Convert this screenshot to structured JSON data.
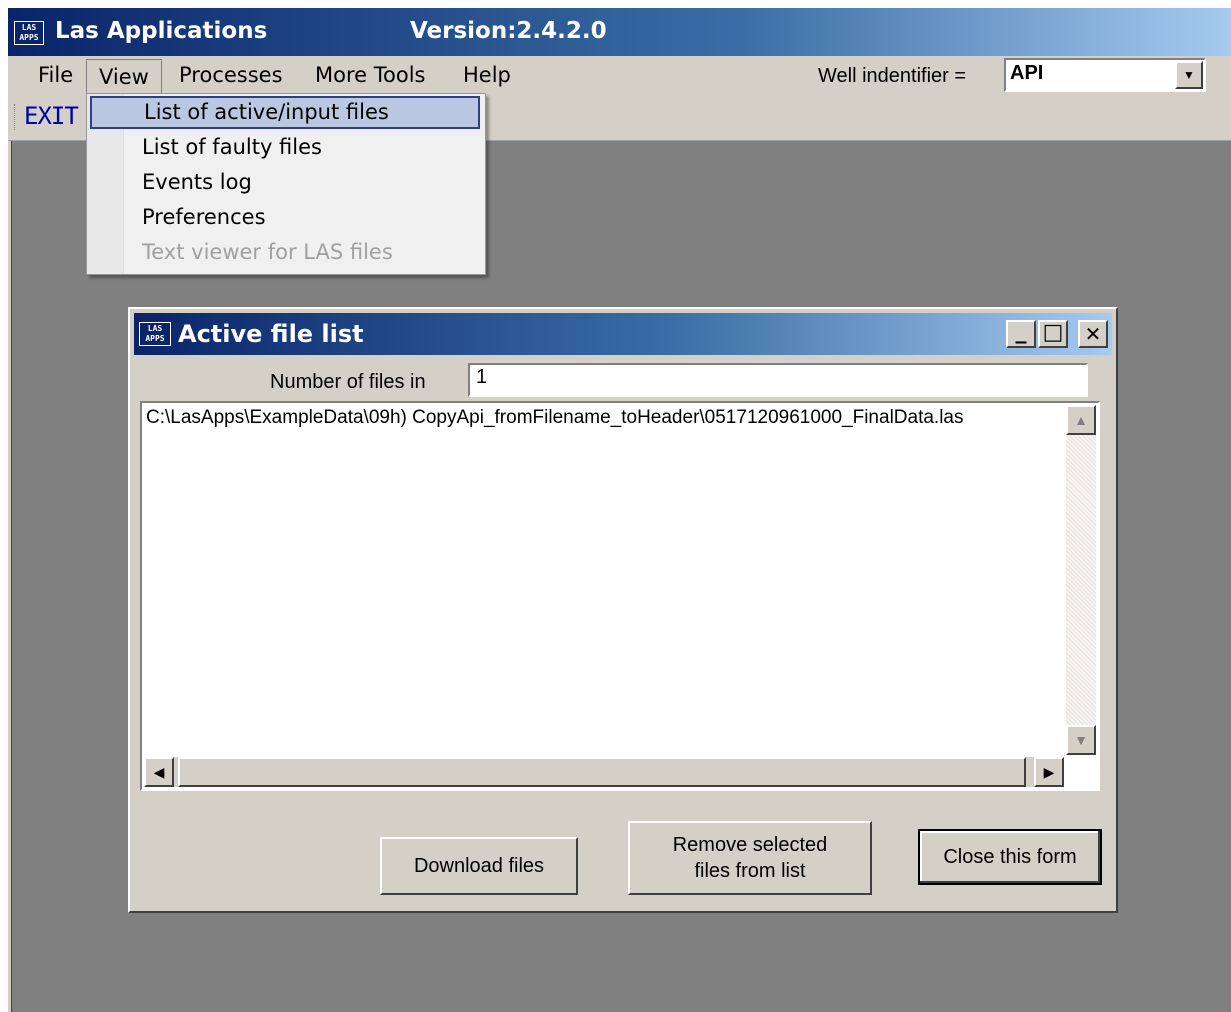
{
  "app": {
    "title": "Las Applications",
    "version": "Version:2.4.2.0",
    "icon_top": "LAS",
    "icon_bottom": "APPS"
  },
  "menubar": {
    "items": [
      "File",
      "View",
      "Processes",
      "More Tools",
      "Help"
    ],
    "active": "View",
    "well_identifier_label": "Well indentifier =",
    "well_identifier_value": "API"
  },
  "toolbar": {
    "exit_label": "EXIT S"
  },
  "view_menu": {
    "items": [
      {
        "label": "List of active/input files",
        "state": "highlighted"
      },
      {
        "label": "List of faulty files",
        "state": "enabled"
      },
      {
        "label": "Events log",
        "state": "enabled"
      },
      {
        "label": "Preferences",
        "state": "enabled"
      },
      {
        "label": "Text viewer for LAS files",
        "state": "disabled"
      }
    ]
  },
  "child_window": {
    "title": "Active file list",
    "icon_top": "LAS",
    "icon_bottom": "APPS",
    "minimize": "_",
    "maximize": "□",
    "close": "✕",
    "files_label": "Number of files in",
    "files_count": "1",
    "files": [
      "C:\\LasApps\\ExampleData\\09h) CopyApi_fromFilename_toHeader\\0517120961000_FinalData.las"
    ],
    "buttons": {
      "download": "Download files",
      "remove_line1": "Remove selected",
      "remove_line2": "files from list",
      "close": "Close this form"
    }
  },
  "colors": {
    "titlebar_start": "#0a246a",
    "titlebar_end": "#a6caf0",
    "workspace": "#808080",
    "face": "#d4d0c8",
    "menu_highlight": "#b9c7e0"
  }
}
